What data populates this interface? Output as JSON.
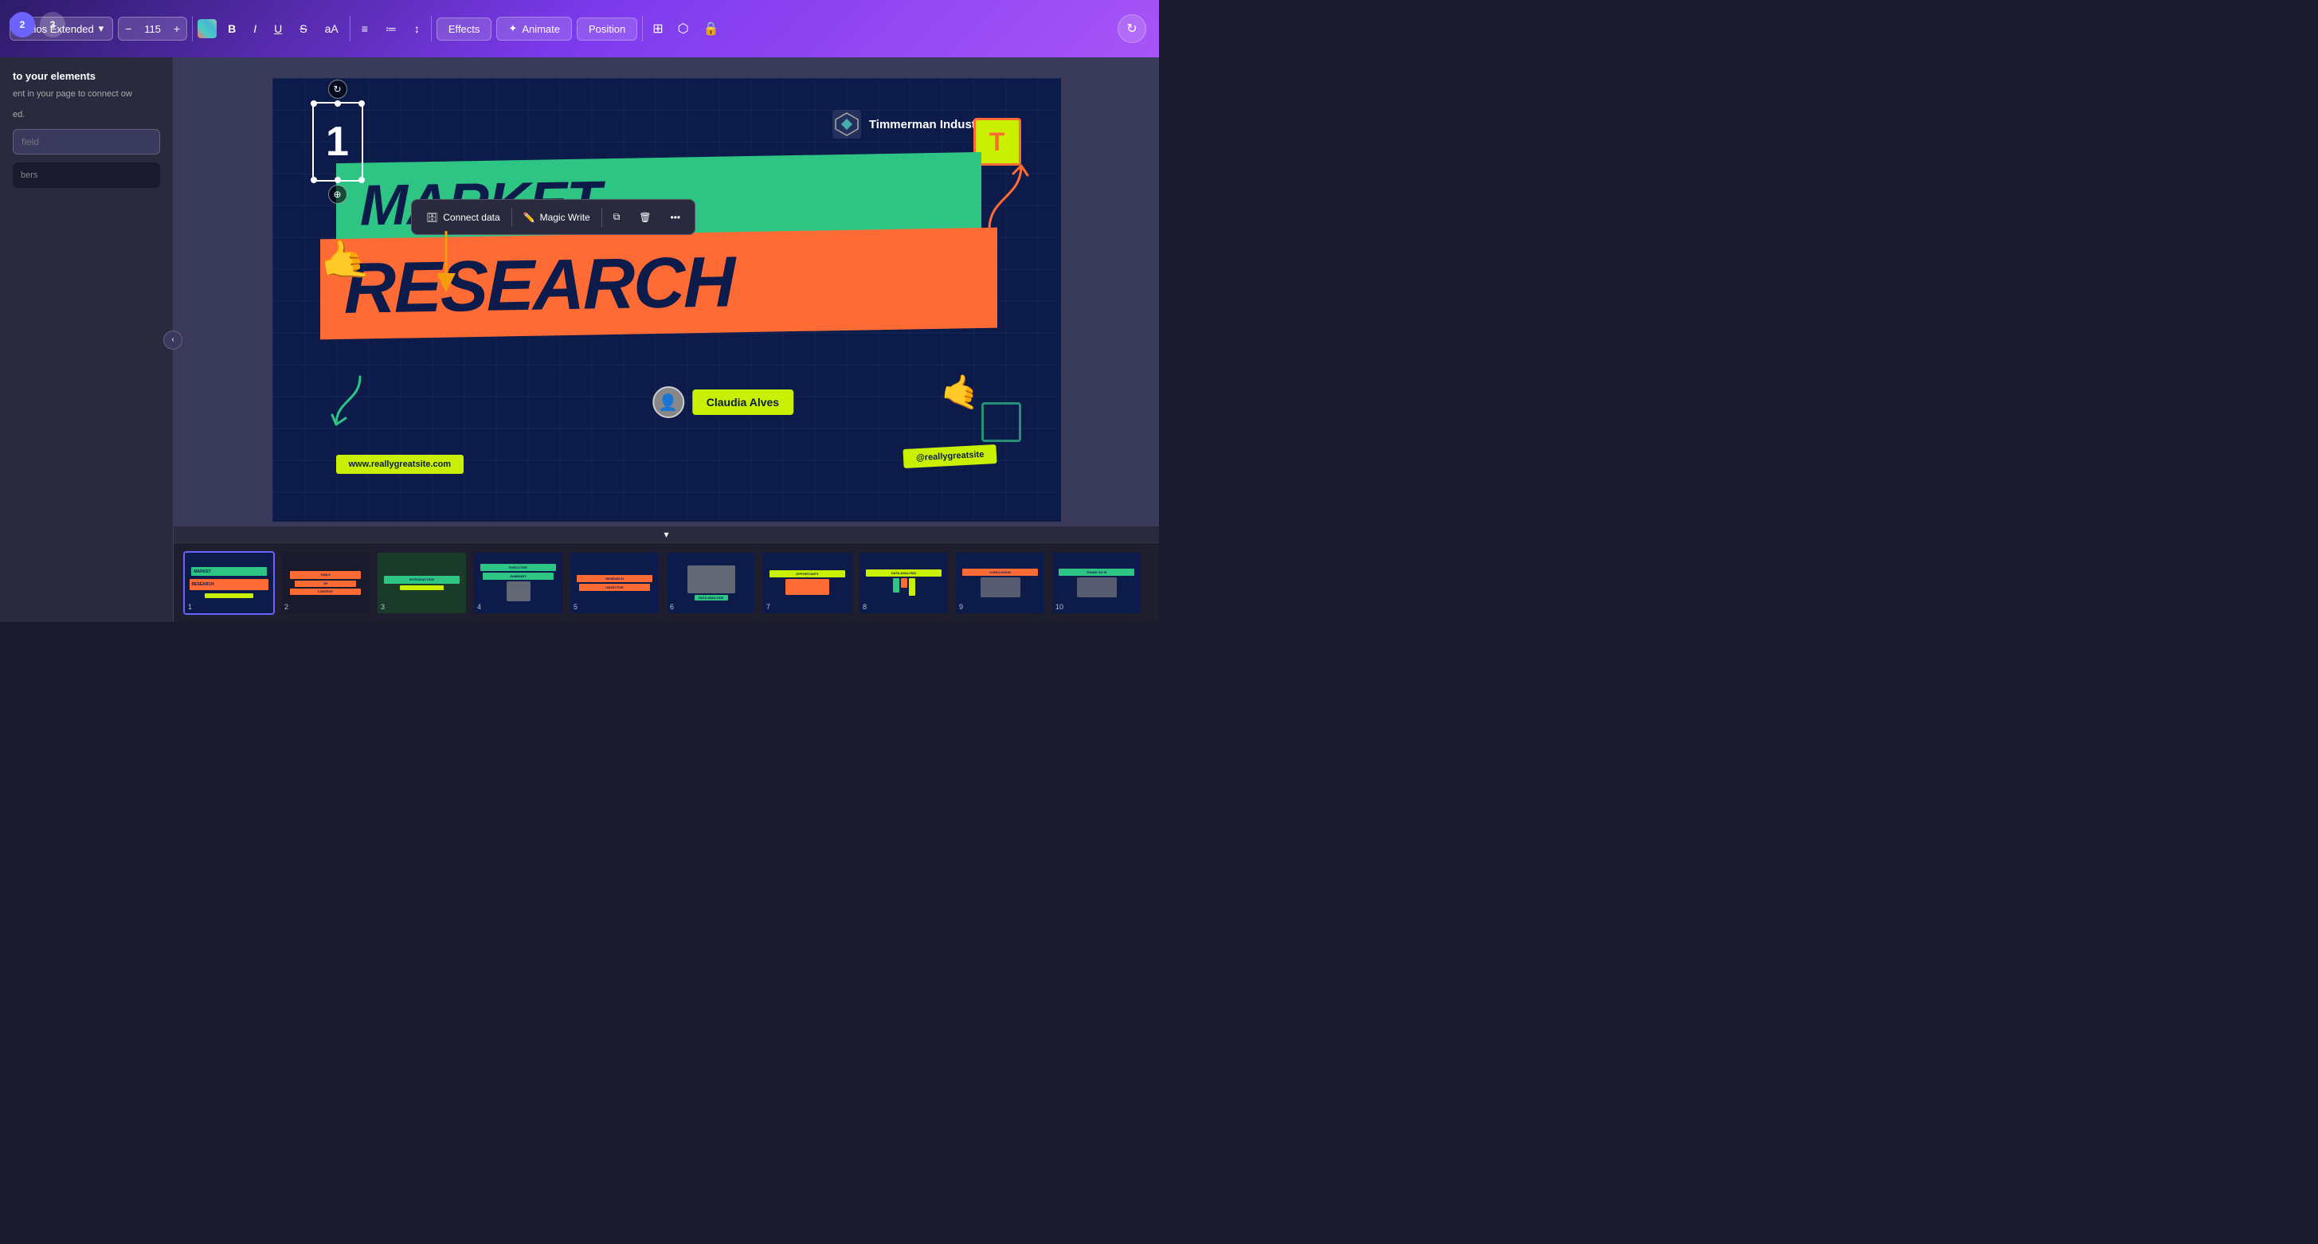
{
  "toolbar": {
    "font_family": "Helios Extended",
    "font_size": "115",
    "decrease_label": "−",
    "increase_label": "+",
    "bold_label": "B",
    "italic_label": "I",
    "underline_label": "U",
    "strikethrough_label": "S",
    "case_label": "aA",
    "align_label": "≡",
    "list_label": "≔",
    "line_height_label": "↕",
    "effects_label": "Effects",
    "animate_label": "Animate",
    "position_label": "Position"
  },
  "sidebar": {
    "title": "to your elements",
    "desc": "ent in your page to connect ow",
    "dot_text": "ed.",
    "input_placeholder": "field",
    "dark_box_text": "bers"
  },
  "slide": {
    "company_name": "Timmerman Industries",
    "market_text": "MARKET",
    "research_text": "RESEARCH",
    "author_name": "Claudia Alves",
    "url_left": "www.reallygreatsite.com",
    "url_right": "@reallygreatsite",
    "number": "1"
  },
  "context_menu": {
    "connect_data": "Connect data",
    "magic_write": "Magic Write",
    "more_label": "•••"
  },
  "filmstrip": {
    "slides": [
      {
        "num": "1",
        "label": "MARKET RESEARCH"
      },
      {
        "num": "2",
        "label": "TABLE OF CONTENT"
      },
      {
        "num": "3",
        "label": "INTRODUCTION"
      },
      {
        "num": "4",
        "label": "EXECUTIVE SUMMARY"
      },
      {
        "num": "5",
        "label": "RESEARCH OBJECTIVE"
      },
      {
        "num": "6",
        "label": "DATA ANALYSIS"
      },
      {
        "num": "7",
        "label": "OPPORTUNITY"
      },
      {
        "num": "8",
        "label": "DATA ANALYSIS"
      },
      {
        "num": "9",
        "label": "CONCLUSION"
      },
      {
        "num": "10",
        "label": "THANK SO M"
      }
    ]
  },
  "steps": {
    "step1": "2",
    "step2": "3"
  }
}
